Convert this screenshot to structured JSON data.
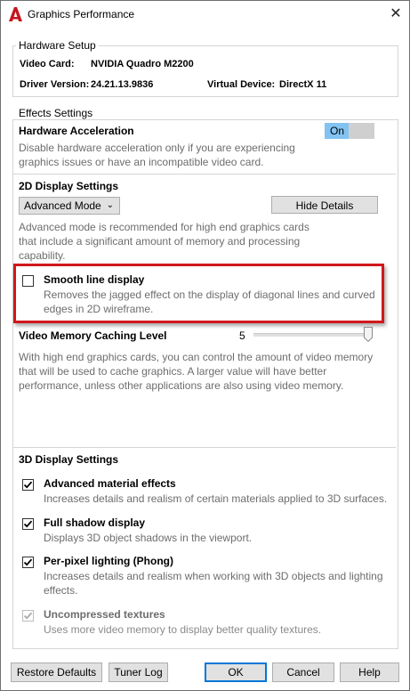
{
  "window": {
    "title": "Graphics Performance",
    "close_glyph": "✕",
    "app_icon": "autocad-a-icon",
    "accent": "#c4161c"
  },
  "hardware": {
    "legend": "Hardware Setup",
    "video_card_label": "Video Card:",
    "video_card_value": "NVIDIA Quadro M2200",
    "driver_label": "Driver Version:",
    "driver_value": "24.21.13.9836",
    "virtual_label": "Virtual Device:",
    "virtual_value": "DirectX 11"
  },
  "effects": {
    "legend": "Effects Settings",
    "hw_accel_title": "Hardware Acceleration",
    "hw_accel_desc_1": "Disable hardware acceleration only if you are experiencing",
    "hw_accel_desc_2": "graphics issues or have an incompatible video card.",
    "toggle_label": "On",
    "display2d_title": "2D Display Settings",
    "mode_value": "Advanced Mode",
    "hide_details_label": "Hide Details",
    "advanced_desc_1": "Advanced mode is recommended for high end graphics cards",
    "advanced_desc_2": "that include a significant amount of memory and processing",
    "advanced_desc_3": "capability.",
    "smooth_title": "Smooth line display",
    "smooth_desc_1": "Removes the jagged effect on the display of diagonal lines and curved",
    "smooth_desc_2": "edges in 2D wireframe.",
    "smooth_checked": false,
    "vmc_title": "Video Memory Caching Level",
    "vmc_value": "5",
    "vmc_desc_1": "With high end graphics cards, you can control the amount of video memory",
    "vmc_desc_2": "that will be used to cache graphics.  A larger value will have better",
    "vmc_desc_3": "performance, unless other applications are also using video memory.",
    "display3d_title": "3D Display Settings",
    "items3d": [
      {
        "title": "Advanced material effects",
        "desc_1": "Increases details and realism of certain materials applied to 3D surfaces.",
        "desc_2": "",
        "checked": true,
        "enabled": true
      },
      {
        "title": "Full shadow display",
        "desc_1": "Displays 3D object shadows in the viewport.",
        "desc_2": "",
        "checked": true,
        "enabled": true
      },
      {
        "title": "Per-pixel lighting (Phong)",
        "desc_1": "Increases details and realism when working with 3D objects and lighting",
        "desc_2": "effects.",
        "checked": true,
        "enabled": true
      },
      {
        "title": "Uncompressed textures",
        "desc_1": "Uses more video memory to display better quality textures.",
        "desc_2": "",
        "checked": true,
        "enabled": false
      }
    ]
  },
  "footer": {
    "restore_label": "Restore Defaults",
    "tuner_label": "Tuner Log",
    "ok_label": "OK",
    "cancel_label": "Cancel",
    "help_label": "Help"
  }
}
